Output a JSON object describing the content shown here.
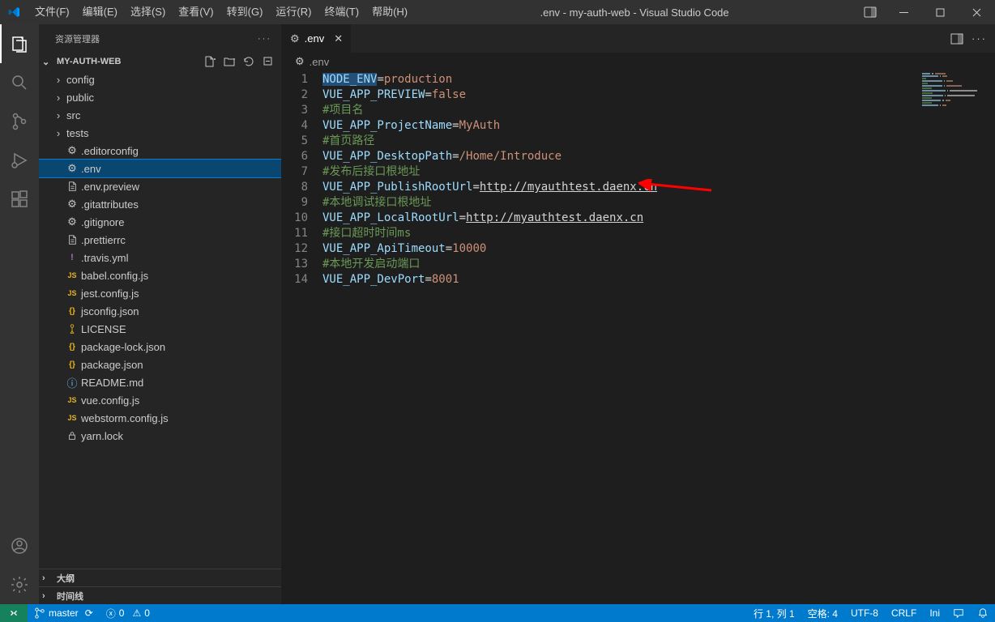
{
  "window": {
    "title": ".env - my-auth-web - Visual Studio Code"
  },
  "menu": {
    "items": [
      "文件(F)",
      "编辑(E)",
      "选择(S)",
      "查看(V)",
      "转到(G)",
      "运行(R)",
      "终端(T)",
      "帮助(H)"
    ]
  },
  "sidebar": {
    "title": "资源管理器",
    "project": "MY-AUTH-WEB",
    "tree": [
      {
        "type": "folder",
        "label": "config"
      },
      {
        "type": "folder",
        "label": "public"
      },
      {
        "type": "folder",
        "label": "src"
      },
      {
        "type": "folder",
        "label": "tests"
      },
      {
        "type": "file",
        "icon": "gear",
        "label": ".editorconfig"
      },
      {
        "type": "file",
        "icon": "gear",
        "label": ".env",
        "selected": true
      },
      {
        "type": "file",
        "icon": "file",
        "label": ".env.preview"
      },
      {
        "type": "file",
        "icon": "gear",
        "label": ".gitattributes"
      },
      {
        "type": "file",
        "icon": "gear",
        "label": ".gitignore"
      },
      {
        "type": "file",
        "icon": "file",
        "label": ".prettierrc"
      },
      {
        "type": "file",
        "icon": "yaml",
        "label": ".travis.yml"
      },
      {
        "type": "file",
        "icon": "js",
        "label": "babel.config.js"
      },
      {
        "type": "file",
        "icon": "js",
        "label": "jest.config.js"
      },
      {
        "type": "file",
        "icon": "json",
        "label": "jsconfig.json"
      },
      {
        "type": "file",
        "icon": "lic",
        "label": "LICENSE"
      },
      {
        "type": "file",
        "icon": "json",
        "label": "package-lock.json"
      },
      {
        "type": "file",
        "icon": "json",
        "label": "package.json"
      },
      {
        "type": "file",
        "icon": "info",
        "label": "README.md"
      },
      {
        "type": "file",
        "icon": "js",
        "label": "vue.config.js"
      },
      {
        "type": "file",
        "icon": "js",
        "label": "webstorm.config.js"
      },
      {
        "type": "file",
        "icon": "lock",
        "label": "yarn.lock"
      }
    ],
    "sections": {
      "outline": "大纲",
      "timeline": "时间线"
    }
  },
  "tabs": {
    "active": {
      "label": ".env"
    }
  },
  "breadcrumb": {
    "label": ".env"
  },
  "editor": {
    "lines": [
      {
        "n": 1,
        "segs": [
          [
            "key",
            "NODE_ENV"
          ],
          [
            "eq",
            "="
          ],
          [
            "val",
            "production"
          ]
        ],
        "sel": true
      },
      {
        "n": 2,
        "segs": [
          [
            "key",
            "VUE_APP_PREVIEW"
          ],
          [
            "eq",
            "="
          ],
          [
            "val",
            "false"
          ]
        ]
      },
      {
        "n": 3,
        "segs": [
          [
            "cmt",
            "#项目名"
          ]
        ]
      },
      {
        "n": 4,
        "segs": [
          [
            "key",
            "VUE_APP_ProjectName"
          ],
          [
            "eq",
            "="
          ],
          [
            "val",
            "MyAuth"
          ]
        ]
      },
      {
        "n": 5,
        "segs": [
          [
            "cmt",
            "#首页路径"
          ]
        ]
      },
      {
        "n": 6,
        "segs": [
          [
            "key",
            "VUE_APP_DesktopPath"
          ],
          [
            "eq",
            "="
          ],
          [
            "val",
            "/Home/Introduce"
          ]
        ]
      },
      {
        "n": 7,
        "segs": [
          [
            "cmt",
            "#发布后接口根地址"
          ]
        ]
      },
      {
        "n": 8,
        "segs": [
          [
            "key",
            "VUE_APP_PublishRootUrl"
          ],
          [
            "eq",
            "="
          ],
          [
            "url",
            "http://myauthtest.daenx.cn"
          ]
        ]
      },
      {
        "n": 9,
        "segs": [
          [
            "cmt",
            "#本地调试接口根地址"
          ]
        ]
      },
      {
        "n": 10,
        "segs": [
          [
            "key",
            "VUE_APP_LocalRootUrl"
          ],
          [
            "eq",
            "="
          ],
          [
            "url",
            "http://myauthtest.daenx.cn"
          ]
        ]
      },
      {
        "n": 11,
        "segs": [
          [
            "cmt",
            "#接口超时时间ms"
          ]
        ]
      },
      {
        "n": 12,
        "segs": [
          [
            "key",
            "VUE_APP_ApiTimeout"
          ],
          [
            "eq",
            "="
          ],
          [
            "val",
            "10000"
          ]
        ]
      },
      {
        "n": 13,
        "segs": [
          [
            "cmt",
            "#本地开发启动端口"
          ]
        ]
      },
      {
        "n": 14,
        "segs": [
          [
            "key",
            "VUE_APP_DevPort"
          ],
          [
            "eq",
            "="
          ],
          [
            "val",
            "8001"
          ]
        ]
      }
    ]
  },
  "statusbar": {
    "branch": "master",
    "errors": "0",
    "warnings": "0",
    "cursor": "行 1, 列 1",
    "spaces": "空格: 4",
    "encoding": "UTF-8",
    "eol": "CRLF",
    "language": "Ini"
  }
}
